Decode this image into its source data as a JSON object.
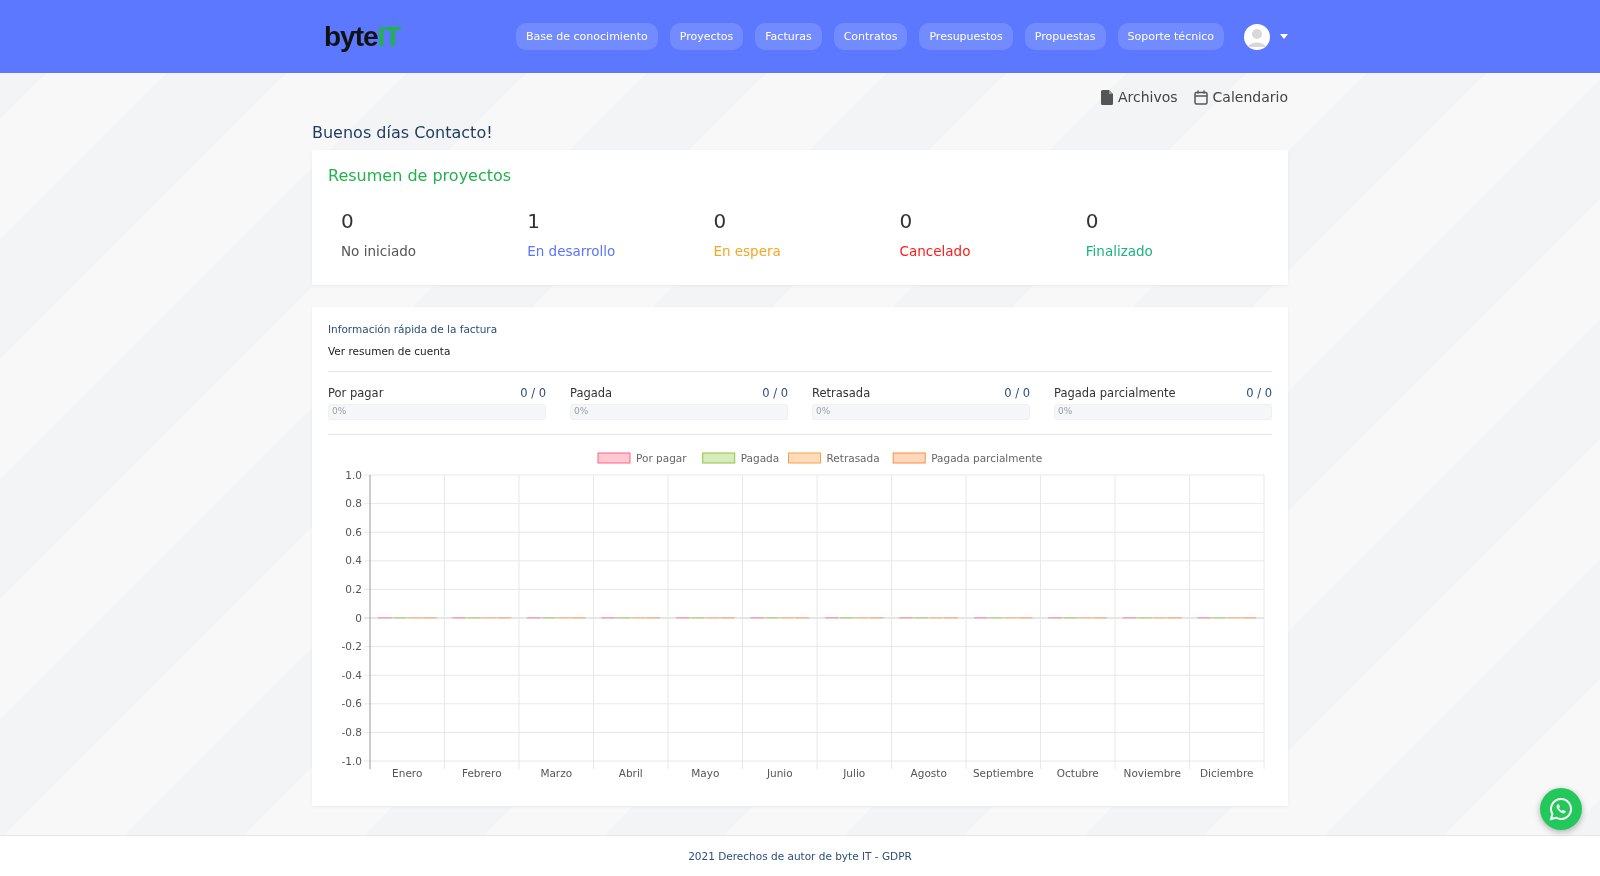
{
  "header": {
    "logo": {
      "text": "byte",
      "accent": "IT"
    },
    "nav": [
      {
        "label": "Base de conocimiento"
      },
      {
        "label": "Proyectos"
      },
      {
        "label": "Facturas"
      },
      {
        "label": "Contratos"
      },
      {
        "label": "Presupuestos"
      },
      {
        "label": "Propuestas"
      },
      {
        "label": "Soporte técnico"
      }
    ]
  },
  "toolbar": [
    {
      "kind": "file",
      "label": "Archivos"
    },
    {
      "kind": "calendar",
      "label": "Calendario"
    }
  ],
  "greeting": "Buenos días Contacto!",
  "project_summary": {
    "title": "Resumen de proyectos",
    "stats": [
      {
        "count": "0",
        "label": "No iniciado",
        "color": "#555555"
      },
      {
        "count": "1",
        "label": "En desarrollo",
        "color": "#5b74ff"
      },
      {
        "count": "0",
        "label": "En espera",
        "color": "#f5a623"
      },
      {
        "count": "0",
        "label": "Cancelado",
        "color": "#ff1a1a"
      },
      {
        "count": "0",
        "label": "Finalizado",
        "color": "#1ab380"
      }
    ]
  },
  "invoice_info": {
    "title": "Información rápida de la factura",
    "link": "Ver resumen de cuenta",
    "progress": [
      {
        "label": "Por pagar",
        "ratio": "0 / 0",
        "level": 0,
        "percent": "0%"
      },
      {
        "label": "Pagada",
        "ratio": "0 / 0",
        "level": 0,
        "percent": "0%"
      },
      {
        "label": "Retrasada",
        "ratio": "0 / 0",
        "level": 0,
        "percent": "0%"
      },
      {
        "label": "Pagada parcialmente",
        "ratio": "0 / 0",
        "level": 0,
        "percent": "0%"
      }
    ],
    "chart_data": {
      "type": "bar",
      "grid": true,
      "legend": "top",
      "categories": [
        "Enero",
        "Febrero",
        "Marzo",
        "Abril",
        "Mayo",
        "Junio",
        "Julio",
        "Agosto",
        "Septiembre",
        "Octubre",
        "Noviembre",
        "Diciembre"
      ],
      "series": [
        {
          "name": "Por pagar",
          "color": "#ff6384",
          "values": [
            0,
            0,
            0,
            0,
            0,
            0,
            0,
            0,
            0,
            0,
            0,
            0
          ]
        },
        {
          "name": "Pagada",
          "color": "#8cc63f",
          "values": [
            0,
            0,
            0,
            0,
            0,
            0,
            0,
            0,
            0,
            0,
            0,
            0
          ]
        },
        {
          "name": "Retrasada",
          "color": "#ff9f40",
          "values": [
            0,
            0,
            0,
            0,
            0,
            0,
            0,
            0,
            0,
            0,
            0,
            0
          ]
        },
        {
          "name": "Pagada parcialmente",
          "color": "#ff8c40",
          "values": [
            0,
            0,
            0,
            0,
            0,
            0,
            0,
            0,
            0,
            0,
            0,
            0
          ]
        }
      ],
      "ylim": [
        -1,
        1
      ],
      "yticks": [
        {
          "value": 1,
          "label": "1.0"
        },
        {
          "value": 0.8,
          "label": "0.8"
        },
        {
          "value": 0.6,
          "label": "0.6"
        },
        {
          "value": 0.4,
          "label": "0.4"
        },
        {
          "value": 0.2,
          "label": "0.2"
        },
        {
          "value": 0,
          "label": "0"
        },
        {
          "value": -0.2,
          "label": "-0.2"
        },
        {
          "value": -0.4,
          "label": "-0.4"
        },
        {
          "value": -0.6,
          "label": "-0.6"
        },
        {
          "value": -0.8,
          "label": "-0.8"
        },
        {
          "value": -1,
          "label": "-1.0"
        }
      ]
    }
  },
  "footer": "2021 Derechos de autor de byte IT - GDPR"
}
